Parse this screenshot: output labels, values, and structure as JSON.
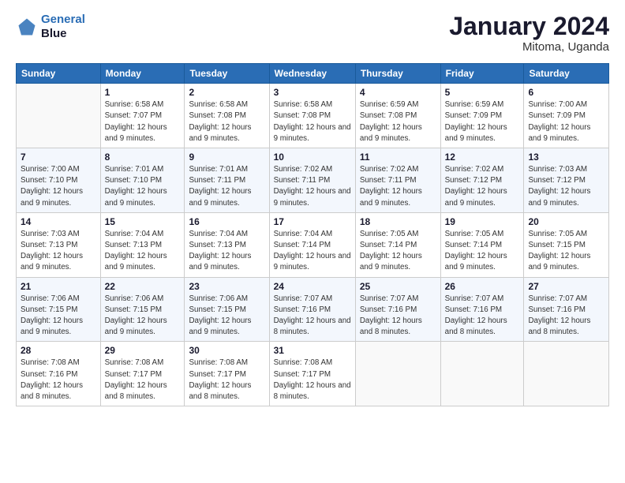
{
  "header": {
    "logo_line1": "General",
    "logo_line2": "Blue",
    "main_title": "January 2024",
    "subtitle": "Mitoma, Uganda"
  },
  "days_of_week": [
    "Sunday",
    "Monday",
    "Tuesday",
    "Wednesday",
    "Thursday",
    "Friday",
    "Saturday"
  ],
  "weeks": [
    [
      {
        "day": "",
        "empty": true
      },
      {
        "day": "1",
        "sunrise": "Sunrise: 6:58 AM",
        "sunset": "Sunset: 7:07 PM",
        "daylight": "Daylight: 12 hours and 9 minutes."
      },
      {
        "day": "2",
        "sunrise": "Sunrise: 6:58 AM",
        "sunset": "Sunset: 7:08 PM",
        "daylight": "Daylight: 12 hours and 9 minutes."
      },
      {
        "day": "3",
        "sunrise": "Sunrise: 6:58 AM",
        "sunset": "Sunset: 7:08 PM",
        "daylight": "Daylight: 12 hours and 9 minutes."
      },
      {
        "day": "4",
        "sunrise": "Sunrise: 6:59 AM",
        "sunset": "Sunset: 7:08 PM",
        "daylight": "Daylight: 12 hours and 9 minutes."
      },
      {
        "day": "5",
        "sunrise": "Sunrise: 6:59 AM",
        "sunset": "Sunset: 7:09 PM",
        "daylight": "Daylight: 12 hours and 9 minutes."
      },
      {
        "day": "6",
        "sunrise": "Sunrise: 7:00 AM",
        "sunset": "Sunset: 7:09 PM",
        "daylight": "Daylight: 12 hours and 9 minutes."
      }
    ],
    [
      {
        "day": "7",
        "sunrise": "Sunrise: 7:00 AM",
        "sunset": "Sunset: 7:10 PM",
        "daylight": "Daylight: 12 hours and 9 minutes."
      },
      {
        "day": "8",
        "sunrise": "Sunrise: 7:01 AM",
        "sunset": "Sunset: 7:10 PM",
        "daylight": "Daylight: 12 hours and 9 minutes."
      },
      {
        "day": "9",
        "sunrise": "Sunrise: 7:01 AM",
        "sunset": "Sunset: 7:11 PM",
        "daylight": "Daylight: 12 hours and 9 minutes."
      },
      {
        "day": "10",
        "sunrise": "Sunrise: 7:02 AM",
        "sunset": "Sunset: 7:11 PM",
        "daylight": "Daylight: 12 hours and 9 minutes."
      },
      {
        "day": "11",
        "sunrise": "Sunrise: 7:02 AM",
        "sunset": "Sunset: 7:11 PM",
        "daylight": "Daylight: 12 hours and 9 minutes."
      },
      {
        "day": "12",
        "sunrise": "Sunrise: 7:02 AM",
        "sunset": "Sunset: 7:12 PM",
        "daylight": "Daylight: 12 hours and 9 minutes."
      },
      {
        "day": "13",
        "sunrise": "Sunrise: 7:03 AM",
        "sunset": "Sunset: 7:12 PM",
        "daylight": "Daylight: 12 hours and 9 minutes."
      }
    ],
    [
      {
        "day": "14",
        "sunrise": "Sunrise: 7:03 AM",
        "sunset": "Sunset: 7:13 PM",
        "daylight": "Daylight: 12 hours and 9 minutes."
      },
      {
        "day": "15",
        "sunrise": "Sunrise: 7:04 AM",
        "sunset": "Sunset: 7:13 PM",
        "daylight": "Daylight: 12 hours and 9 minutes."
      },
      {
        "day": "16",
        "sunrise": "Sunrise: 7:04 AM",
        "sunset": "Sunset: 7:13 PM",
        "daylight": "Daylight: 12 hours and 9 minutes."
      },
      {
        "day": "17",
        "sunrise": "Sunrise: 7:04 AM",
        "sunset": "Sunset: 7:14 PM",
        "daylight": "Daylight: 12 hours and 9 minutes."
      },
      {
        "day": "18",
        "sunrise": "Sunrise: 7:05 AM",
        "sunset": "Sunset: 7:14 PM",
        "daylight": "Daylight: 12 hours and 9 minutes."
      },
      {
        "day": "19",
        "sunrise": "Sunrise: 7:05 AM",
        "sunset": "Sunset: 7:14 PM",
        "daylight": "Daylight: 12 hours and 9 minutes."
      },
      {
        "day": "20",
        "sunrise": "Sunrise: 7:05 AM",
        "sunset": "Sunset: 7:15 PM",
        "daylight": "Daylight: 12 hours and 9 minutes."
      }
    ],
    [
      {
        "day": "21",
        "sunrise": "Sunrise: 7:06 AM",
        "sunset": "Sunset: 7:15 PM",
        "daylight": "Daylight: 12 hours and 9 minutes."
      },
      {
        "day": "22",
        "sunrise": "Sunrise: 7:06 AM",
        "sunset": "Sunset: 7:15 PM",
        "daylight": "Daylight: 12 hours and 9 minutes."
      },
      {
        "day": "23",
        "sunrise": "Sunrise: 7:06 AM",
        "sunset": "Sunset: 7:15 PM",
        "daylight": "Daylight: 12 hours and 9 minutes."
      },
      {
        "day": "24",
        "sunrise": "Sunrise: 7:07 AM",
        "sunset": "Sunset: 7:16 PM",
        "daylight": "Daylight: 12 hours and 8 minutes."
      },
      {
        "day": "25",
        "sunrise": "Sunrise: 7:07 AM",
        "sunset": "Sunset: 7:16 PM",
        "daylight": "Daylight: 12 hours and 8 minutes."
      },
      {
        "day": "26",
        "sunrise": "Sunrise: 7:07 AM",
        "sunset": "Sunset: 7:16 PM",
        "daylight": "Daylight: 12 hours and 8 minutes."
      },
      {
        "day": "27",
        "sunrise": "Sunrise: 7:07 AM",
        "sunset": "Sunset: 7:16 PM",
        "daylight": "Daylight: 12 hours and 8 minutes."
      }
    ],
    [
      {
        "day": "28",
        "sunrise": "Sunrise: 7:08 AM",
        "sunset": "Sunset: 7:16 PM",
        "daylight": "Daylight: 12 hours and 8 minutes."
      },
      {
        "day": "29",
        "sunrise": "Sunrise: 7:08 AM",
        "sunset": "Sunset: 7:17 PM",
        "daylight": "Daylight: 12 hours and 8 minutes."
      },
      {
        "day": "30",
        "sunrise": "Sunrise: 7:08 AM",
        "sunset": "Sunset: 7:17 PM",
        "daylight": "Daylight: 12 hours and 8 minutes."
      },
      {
        "day": "31",
        "sunrise": "Sunrise: 7:08 AM",
        "sunset": "Sunset: 7:17 PM",
        "daylight": "Daylight: 12 hours and 8 minutes."
      },
      {
        "day": "",
        "empty": true
      },
      {
        "day": "",
        "empty": true
      },
      {
        "day": "",
        "empty": true
      }
    ]
  ]
}
